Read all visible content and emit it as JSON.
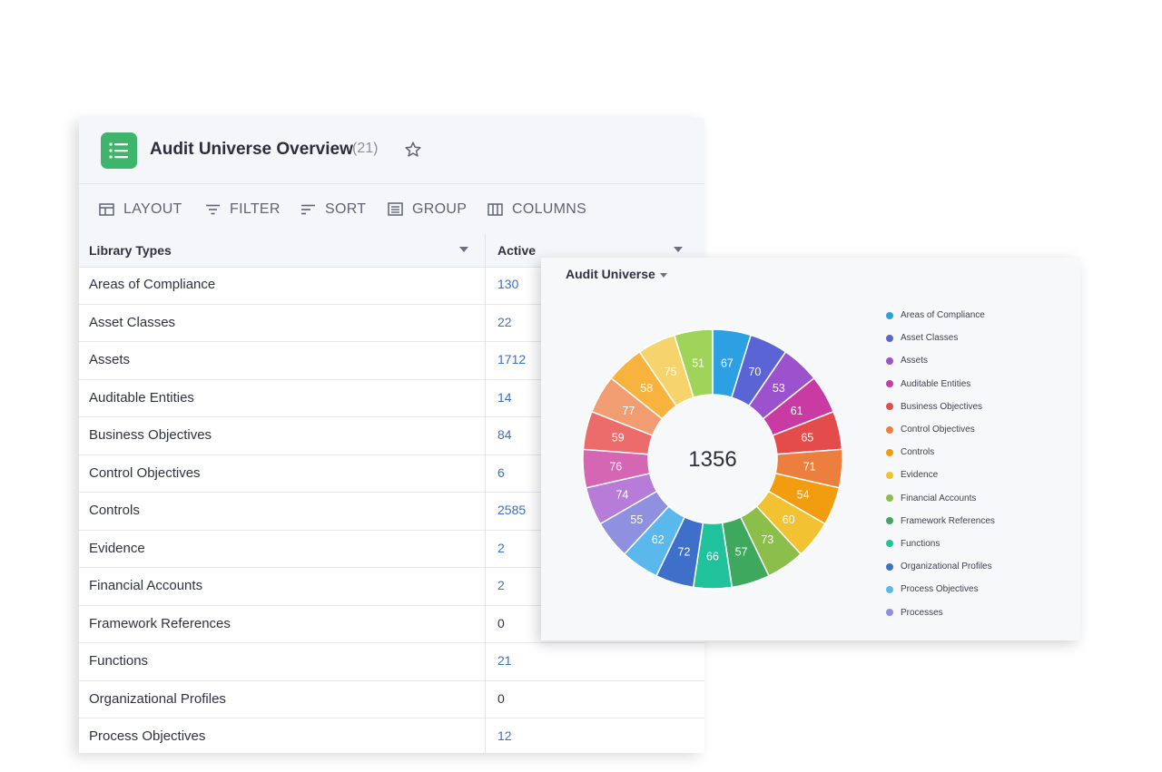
{
  "header": {
    "title": "Audit Universe Overview",
    "count": "(21)",
    "app_icon": "list-icon",
    "app_icon_color": "#3fb56b",
    "favorite_icon": "star-outline-icon"
  },
  "toolbar": [
    {
      "label": "LAYOUT",
      "icon": "layout-icon"
    },
    {
      "label": "FILTER",
      "icon": "filter-icon"
    },
    {
      "label": "SORT",
      "icon": "sort-icon"
    },
    {
      "label": "GROUP",
      "icon": "group-icon"
    },
    {
      "label": "COLUMNS",
      "icon": "columns-icon"
    }
  ],
  "table": {
    "columns": [
      {
        "label": "Library Types"
      },
      {
        "label": "Active"
      }
    ],
    "link_color": "#3b6fc4",
    "rows": [
      {
        "name": "Areas of Compliance",
        "active": "130",
        "link": true
      },
      {
        "name": "Asset Classes",
        "active": "22",
        "link": true
      },
      {
        "name": "Assets",
        "active": "1712",
        "link": true
      },
      {
        "name": "Auditable Entities",
        "active": "14",
        "link": true
      },
      {
        "name": "Business Objectives",
        "active": "84",
        "link": true
      },
      {
        "name": "Control Objectives",
        "active": "6",
        "link": true
      },
      {
        "name": "Controls",
        "active": "2585",
        "link": true
      },
      {
        "name": "Evidence",
        "active": "2",
        "link": true
      },
      {
        "name": "Financial Accounts",
        "active": "2",
        "link": true
      },
      {
        "name": "Framework References",
        "active": "0",
        "link": false
      },
      {
        "name": "Functions",
        "active": "21",
        "link": true
      },
      {
        "name": "Organizational Profiles",
        "active": "0",
        "link": false
      },
      {
        "name": "Process Objectives",
        "active": "12",
        "link": true
      }
    ]
  },
  "chart_panel": {
    "title": "Audit Universe"
  },
  "chart_data": {
    "type": "pie",
    "center_label": "1356",
    "values": [
      67,
      70,
      53,
      61,
      65,
      71,
      54,
      60,
      73,
      57,
      66,
      72,
      62,
      55,
      74,
      76,
      59,
      77,
      58,
      75,
      51
    ],
    "colors": [
      "#2d9fe3",
      "#5a64d4",
      "#9b52cc",
      "#c93aa3",
      "#e44b4b",
      "#ec7f3e",
      "#f29d0f",
      "#f2c233",
      "#8bbe4a",
      "#3ea85e",
      "#1fc29b",
      "#3e6fc9",
      "#5ab8ec",
      "#8f90e0",
      "#b67cd8",
      "#d466b3",
      "#ec6b6b",
      "#f29c72",
      "#f7b33e",
      "#f7d36b",
      "#9fd35a"
    ],
    "legend": [
      {
        "label": "Areas of Compliance",
        "color": "#2d9fe3"
      },
      {
        "label": "Asset Classes",
        "color": "#5a64d4"
      },
      {
        "label": "Assets",
        "color": "#9b52cc"
      },
      {
        "label": "Auditable Entities",
        "color": "#c93aa3"
      },
      {
        "label": "Business Objectives",
        "color": "#e44b4b"
      },
      {
        "label": "Control Objectives",
        "color": "#ec7f3e"
      },
      {
        "label": "Controls",
        "color": "#f29d0f"
      },
      {
        "label": "Evidence",
        "color": "#f2c233"
      },
      {
        "label": "Financial Accounts",
        "color": "#8bbe4a"
      },
      {
        "label": "Framework References",
        "color": "#3ea85e"
      },
      {
        "label": "Functions",
        "color": "#1fc29b"
      },
      {
        "label": "Organizational Profiles",
        "color": "#3e6fc9"
      },
      {
        "label": "Process Objectives",
        "color": "#5ab8ec"
      },
      {
        "label": "Processes",
        "color": "#8f90e0"
      }
    ]
  }
}
